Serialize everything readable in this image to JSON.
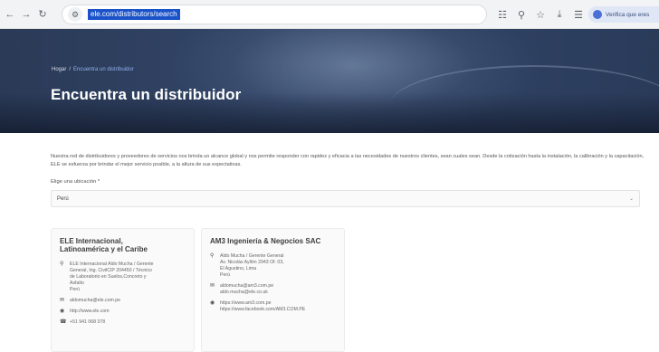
{
  "browser": {
    "url": "ele.com/distributors/search",
    "profile_label": "Verifica que eres"
  },
  "hero": {
    "breadcrumb": {
      "home": "Hogar",
      "separator": "/",
      "current": "Encuentra un distribuidor"
    },
    "title": "Encuentra un distribuidor"
  },
  "intro": {
    "line1": "Nuestra red de distribuidores y proveedores de servicios nos brinda un alcance global y nos permite responder con rapidez y eficacia a las necesidades de nuestros clientes, sean cuales sean. Desde la",
    "line2": "cotización hasta la instalación, la calibración y la capacitación, ELE se esfuerza por brindar el mejor servicio posible, a la altura de sus expectativas."
  },
  "location": {
    "label": "Elige una ubicación *",
    "value": "Perú"
  },
  "distributors": [
    {
      "name_line1": "ELE Internacional,",
      "name_line2": "Latinoamérica y el Caribe",
      "address": [
        "ELE Internacional Aldo Mucha / Gerente",
        "General, Ing. CivilCIP 204450 / Técnico",
        "de Laboratorio en Suelos,Concreto y",
        "Asfalto",
        "Perú"
      ],
      "email": [
        "aldomucha@ele.com.pe"
      ],
      "web": [
        "http://www.ele.com"
      ],
      "phone": "+51 941 068 378"
    },
    {
      "name_line1": "AM3 Ingeniería & Negocios SAC",
      "address": [
        "Aldo Mucha / Gerente General",
        "Av. Nicolás Ayllón 2943 Of. 03,",
        "El Agustino, Lima",
        "Perú"
      ],
      "email": [
        "aldomucha@am3.com.pe",
        "aldo.mucha@ele.co.uk"
      ],
      "web": [
        "https://www.am3.com.pe",
        "https://www.facebook.com/AM3.COM.PE"
      ]
    }
  ],
  "icons": {
    "back": "back-arrow-icon",
    "forward": "forward-arrow-icon",
    "reload": "reload-icon",
    "site_info": "site-info-icon",
    "translate": "translate-icon",
    "zoom": "zoom-icon",
    "bookmark": "star-icon",
    "download": "download-icon",
    "extensions": "extensions-icon",
    "location": "map-pin-icon",
    "email": "envelope-icon",
    "web": "globe-icon",
    "phone": "phone-icon"
  },
  "colors": {
    "hero_bg": "#2f4263",
    "breadcrumb_current": "#8fb0e8",
    "url_highlight": "#1a52c9"
  }
}
